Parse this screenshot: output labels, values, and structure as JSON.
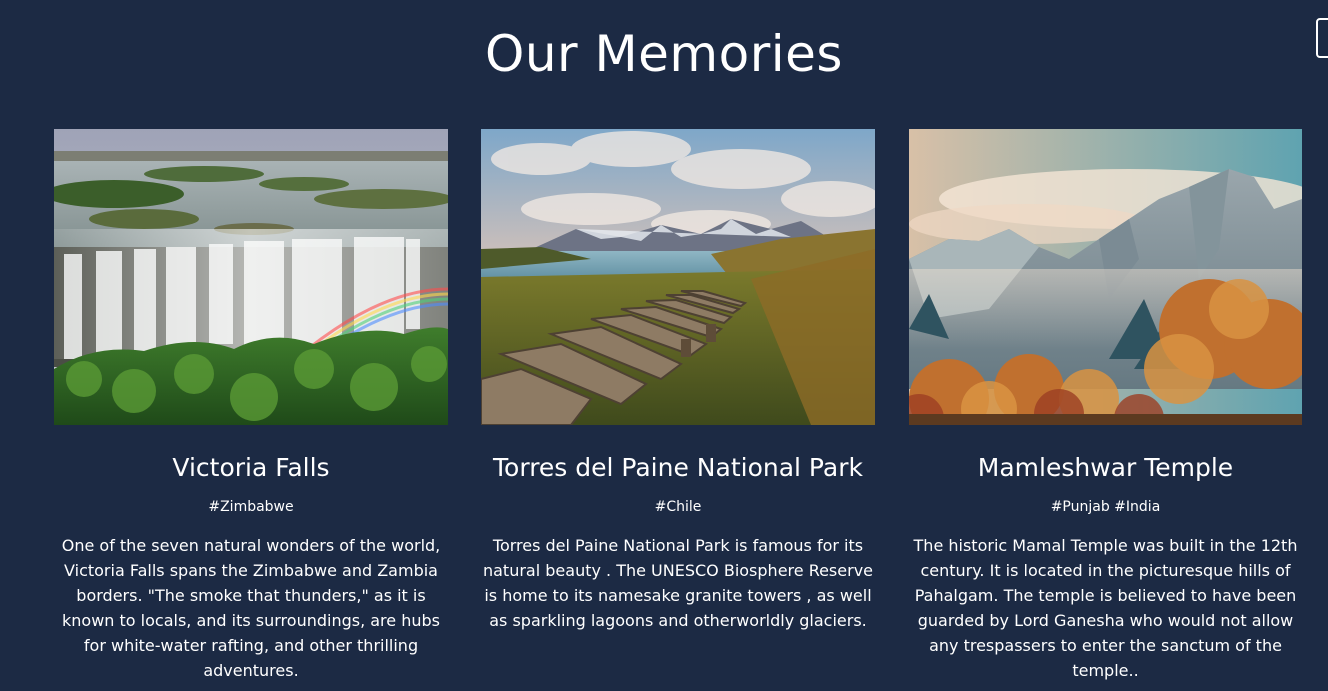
{
  "section": {
    "title": "Our Memories"
  },
  "cards": [
    {
      "image": "waterfall-rainbow-photo",
      "title": "Victoria Falls",
      "tags": "#Zimbabwe",
      "description": "One of the seven natural wonders of the world, Victoria Falls spans the Zimbabwe and Zambia borders. \"The smoke that thunders,\" as it is known to locals, and its surroundings, are hubs for white-water rafting, and other thrilling adventures."
    },
    {
      "image": "mountain-boardwalk-photo",
      "title": "Torres del Paine National Park",
      "tags": "#Chile",
      "description": "Torres del Paine National Park is famous for its natural beauty . The UNESCO Biosphere Reserve is home to its namesake granite towers , as well as sparkling lagoons and otherworldly glaciers."
    },
    {
      "image": "autumn-mountains-photo",
      "title": "Mamleshwar Temple",
      "tags": "#Punjab #India",
      "description": "The historic Mamal Temple was built in the 12th century. It is located in the picturesque hills of Pahalgam. The temple is believed to have been guarded by Lord Ganesha who would not allow any trespassers to enter the sanctum of the temple.."
    }
  ],
  "colors": {
    "background": "#1c2a44",
    "text": "#ffffff"
  }
}
